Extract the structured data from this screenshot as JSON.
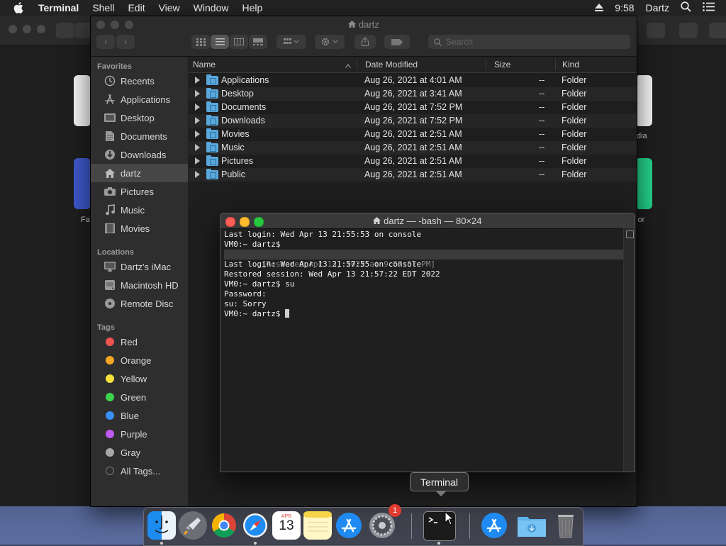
{
  "menubar": {
    "app_name": "Terminal",
    "menus": [
      "Shell",
      "Edit",
      "View",
      "Window",
      "Help"
    ],
    "clock": "9:58",
    "user": "Dartz"
  },
  "background_window": {
    "labels": [
      "dia",
      "Fa",
      "sor"
    ]
  },
  "finder": {
    "title": "dartz",
    "search_placeholder": "Search",
    "sidebar": {
      "favorites_heading": "Favorites",
      "favorites": [
        {
          "label": "Recents",
          "icon": "clock-icon"
        },
        {
          "label": "Applications",
          "icon": "applications-icon"
        },
        {
          "label": "Desktop",
          "icon": "desktop-icon"
        },
        {
          "label": "Documents",
          "icon": "document-icon"
        },
        {
          "label": "Downloads",
          "icon": "download-icon"
        },
        {
          "label": "dartz",
          "icon": "home-icon",
          "selected": true
        },
        {
          "label": "Pictures",
          "icon": "camera-icon"
        },
        {
          "label": "Music",
          "icon": "music-note-icon"
        },
        {
          "label": "Movies",
          "icon": "film-icon"
        }
      ],
      "locations_heading": "Locations",
      "locations": [
        {
          "label": "Dartz's iMac",
          "icon": "imac-icon"
        },
        {
          "label": "Macintosh HD",
          "icon": "hard-drive-icon"
        },
        {
          "label": "Remote Disc",
          "icon": "disc-icon"
        }
      ],
      "tags_heading": "Tags",
      "tags": [
        {
          "label": "Red",
          "color": "#ef5350"
        },
        {
          "label": "Orange",
          "color": "#f5a623"
        },
        {
          "label": "Yellow",
          "color": "#f7e13b"
        },
        {
          "label": "Green",
          "color": "#3dd34e"
        },
        {
          "label": "Blue",
          "color": "#3a8ef6"
        },
        {
          "label": "Purple",
          "color": "#bf5af2"
        },
        {
          "label": "Gray",
          "color": "#a8a8a8"
        },
        {
          "label": "All Tags...",
          "color": ""
        }
      ]
    },
    "columns": {
      "name": "Name",
      "date": "Date Modified",
      "size": "Size",
      "kind": "Kind"
    },
    "rows": [
      {
        "name": "Applications",
        "date": "Aug 26, 2021 at 4:01 AM",
        "size": "--",
        "kind": "Folder"
      },
      {
        "name": "Desktop",
        "date": "Aug 26, 2021 at 3:41 AM",
        "size": "--",
        "kind": "Folder"
      },
      {
        "name": "Documents",
        "date": "Aug 26, 2021 at 7:52 PM",
        "size": "--",
        "kind": "Folder"
      },
      {
        "name": "Downloads",
        "date": "Aug 26, 2021 at 7:52 PM",
        "size": "--",
        "kind": "Folder"
      },
      {
        "name": "Movies",
        "date": "Aug 26, 2021 at 2:51 AM",
        "size": "--",
        "kind": "Folder"
      },
      {
        "name": "Music",
        "date": "Aug 26, 2021 at 2:51 AM",
        "size": "--",
        "kind": "Folder"
      },
      {
        "name": "Pictures",
        "date": "Aug 26, 2021 at 2:51 AM",
        "size": "--",
        "kind": "Folder"
      },
      {
        "name": "Public",
        "date": "Aug 26, 2021 at 2:51 AM",
        "size": "--",
        "kind": "Folder"
      }
    ]
  },
  "terminal": {
    "title": "dartz — -bash — 80×24",
    "lines": [
      "Last login: Wed Apr 13 21:55:53 on console",
      "VM0:~ dartz$",
      "  [Restored Apr 13, 2022 at 9:57:57 PM]",
      "Last login: Wed Apr 13 21:57:55 on console",
      "Restored session: Wed Apr 13 21:57:22 EDT 2022",
      "VM0:~ dartz$ su",
      "Password:",
      "su: Sorry",
      "VM0:~ dartz$ "
    ]
  },
  "tooltip": "Terminal",
  "dock": {
    "apps": [
      "Finder",
      "Launchpad",
      "Google Chrome",
      "Safari",
      "Calendar",
      "Notes",
      "App Store",
      "System Preferences",
      "Terminal",
      "App Store",
      "Downloads",
      "Trash"
    ],
    "calendar_month": "APR",
    "calendar_day": "13",
    "prefs_badge": "1"
  }
}
